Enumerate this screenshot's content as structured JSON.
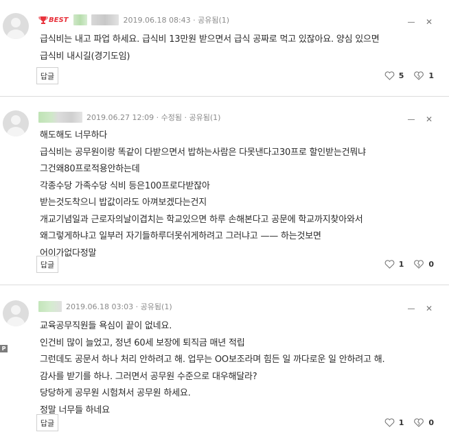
{
  "comments": [
    {
      "badge": "BEST",
      "meta": "2019.06.18 08:43 · 공유됨(1)",
      "lines": [
        "급식비는 내고 파업 하세요. 급식비 13만원 받으면서 급식 공짜로 먹고 있잖아요. 양심 있으면",
        "급식비 내시길(경기도임)"
      ],
      "reply_label": "답글",
      "likes": "5",
      "dislikes": "1"
    },
    {
      "meta": "2019.06.27 12:09 · 수정됨 · 공유됨(1)",
      "lines": [
        "해도해도 너무하다",
        "급식비는 공무원이랑 똑같이 다받으면서 밥하는사람은 다못낸다고30프로 할인받는건뭐냐",
        "그건왜80프로적용안하는데",
        "각종수당 가족수당 식비 등은100프로다받잖아",
        "받는것도착으니 밥값이라도 아껴보겠다는건지",
        "개교기념일과 근로자의날이겹치는 학교있으면 하루 손해본다고 공문에 학교까지찾아와서",
        "왜그렇게하냐고 일부러 자기들하루더못쉬게하려고 그러냐고 —— 하는것보면",
        "어이가없다정말"
      ],
      "reply_label": "답글",
      "likes": "1",
      "dislikes": "0"
    },
    {
      "meta": "2019.06.18 03:03 · 공유됨(1)",
      "lines": [
        "교육공무직원들 욕심이 끝이 없네요.",
        "인건비 많이 늘었고, 정년 60세 보장에 퇴직금 매년 적립",
        "그런데도 공문서 하나 처리 안하려고 해. 업무는 OO보조라며 힘든 일 까다로운 일 안하려고 해.",
        "감사를 받기를 하나. 그러면서 공무원 수준으로 대우해달라?",
        "당당하게 공무원 시험쳐서 공무원 하세요.",
        "정말 너무들 하네요"
      ],
      "reply_label": "답글",
      "likes": "1",
      "dislikes": "0"
    }
  ],
  "side_marker": "P",
  "icons": {
    "avatar": "default-profile-icon",
    "best": "trophy-icon",
    "like": "heart-outline-icon",
    "dislike": "broken-heart-icon",
    "menu_minimize": "minus-icon",
    "menu_close": "close-icon"
  },
  "colors": {
    "best_red": "#e8323c",
    "meta_gray": "#8a8a8a",
    "divider": "#dcdcdc"
  }
}
